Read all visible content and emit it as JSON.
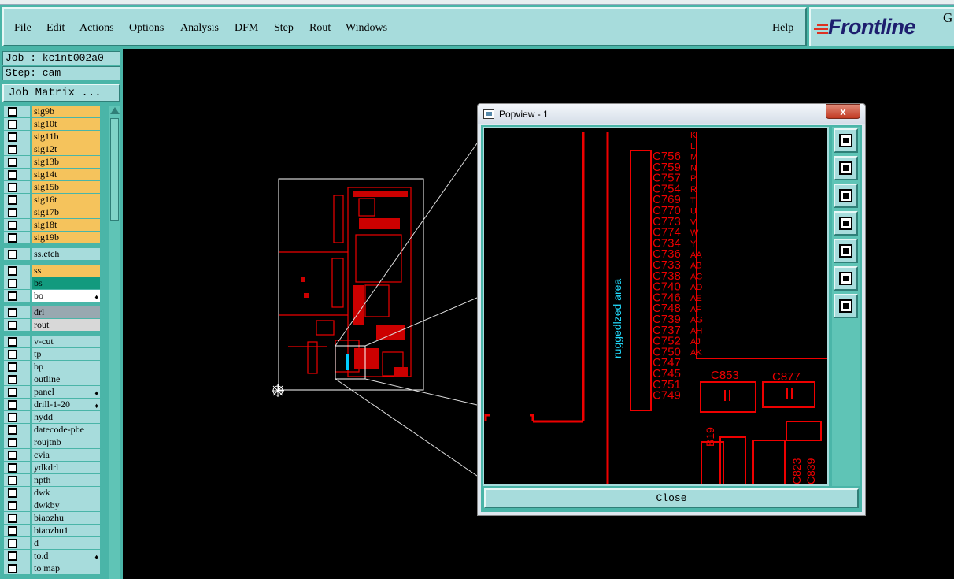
{
  "menu": {
    "items": [
      "File",
      "Edit",
      "Actions",
      "Options",
      "Analysis",
      "DFM",
      "Step",
      "Rout",
      "Windows"
    ],
    "help": "Help"
  },
  "logo": {
    "text": "Frontline",
    "suffix": "G"
  },
  "job": {
    "label": "Job : kc1nt002a0",
    "step": "Step: cam",
    "matrix_button": "Job Matrix ..."
  },
  "layers": [
    {
      "name": "sig9b",
      "color": "#f5c35c"
    },
    {
      "name": "sig10t",
      "color": "#f5c35c"
    },
    {
      "name": "sig11b",
      "color": "#f5c35c"
    },
    {
      "name": "sig12t",
      "color": "#f5c35c"
    },
    {
      "name": "sig13b",
      "color": "#f5c35c"
    },
    {
      "name": "sig14t",
      "color": "#f5c35c"
    },
    {
      "name": "sig15b",
      "color": "#f5c35c"
    },
    {
      "name": "sig16t",
      "color": "#f5c35c"
    },
    {
      "name": "sig17b",
      "color": "#f5c35c"
    },
    {
      "name": "sig18t",
      "color": "#f5c35c"
    },
    {
      "name": "sig19b",
      "color": "#f5c35c"
    },
    {
      "name": "ss.etch",
      "color": "#a7dcdc",
      "gap": true
    },
    {
      "name": "ss",
      "color": "#f5c35c",
      "gap": true
    },
    {
      "name": "bs",
      "color": "#129a7e"
    },
    {
      "name": "bo",
      "color": "#ffffff",
      "mark": "♦"
    },
    {
      "name": "drl",
      "color": "#98a8b0",
      "gap": true
    },
    {
      "name": "rout",
      "color": "#d8d8d8"
    },
    {
      "name": "v-cut",
      "color": "#a7dcdc",
      "gap": true
    },
    {
      "name": "tp",
      "color": "#a7dcdc"
    },
    {
      "name": "bp",
      "color": "#a7dcdc"
    },
    {
      "name": "outline",
      "color": "#a7dcdc"
    },
    {
      "name": "panel",
      "color": "#a7dcdc",
      "mark": "♦"
    },
    {
      "name": "drill-1-20",
      "color": "#a7dcdc",
      "mark": "♦"
    },
    {
      "name": "hydd",
      "color": "#a7dcdc"
    },
    {
      "name": "datecode-pbe",
      "color": "#a7dcdc"
    },
    {
      "name": "roujtnb",
      "color": "#a7dcdc"
    },
    {
      "name": "cvia",
      "color": "#a7dcdc"
    },
    {
      "name": "ydkdrl",
      "color": "#a7dcdc"
    },
    {
      "name": "npth",
      "color": "#a7dcdc"
    },
    {
      "name": "dwk",
      "color": "#a7dcdc"
    },
    {
      "name": "dwkby",
      "color": "#a7dcdc"
    },
    {
      "name": "biaozhu",
      "color": "#a7dcdc"
    },
    {
      "name": "biaozhu1",
      "color": "#a7dcdc"
    },
    {
      "name": "d",
      "color": "#a7dcdc"
    },
    {
      "name": "to.d",
      "color": "#a7dcdc",
      "mark": "♦"
    },
    {
      "name": "to map",
      "color": "#a7dcdc"
    }
  ],
  "popview": {
    "title": "Popview - 1",
    "close_x": "x",
    "close_button": "Close",
    "area_label": "ruggedlzed area",
    "components": [
      "C756",
      "C759",
      "C757",
      "C754",
      "C769",
      "C770",
      "C773",
      "C774",
      "C734",
      "C736",
      "C733",
      "C738",
      "C740",
      "C746",
      "C748",
      "C739",
      "C737",
      "C752",
      "C750",
      "C747",
      "C745",
      "C751",
      "C749"
    ],
    "rows": [
      "K",
      "L",
      "M",
      "N",
      "P",
      "R",
      "T",
      "U",
      "V",
      "W",
      "Y",
      "AA",
      "AB",
      "AC",
      "AD",
      "AE",
      "AF",
      "AG",
      "AH",
      "AJ",
      "AK"
    ],
    "caps": [
      "C853",
      "C877"
    ],
    "misc": [
      "B19",
      "C823",
      "C839"
    ]
  }
}
